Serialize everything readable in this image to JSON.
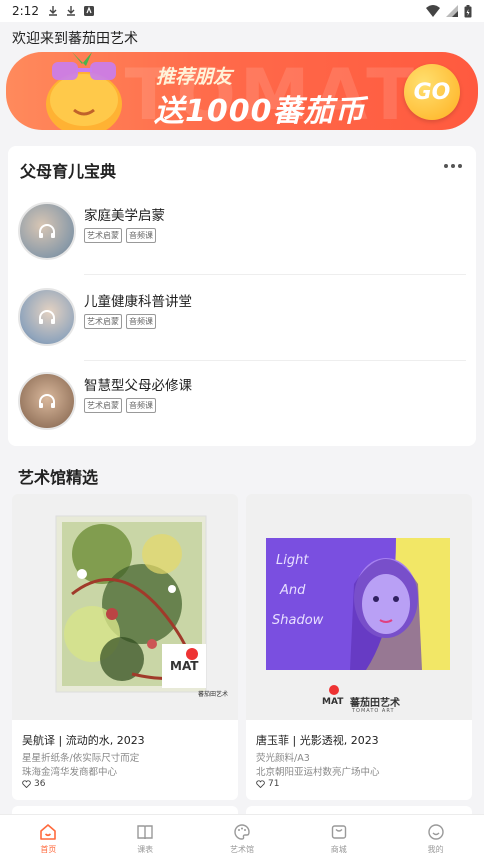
{
  "status_bar": {
    "time": "2:12"
  },
  "welcome": "欢迎来到蕃茄田艺术",
  "banner": {
    "line1": "推荐朋友",
    "line2": "送1000蕃茄币",
    "go_label": "GO",
    "bg_text": "TOMAT"
  },
  "courses_card": {
    "title": "父母育儿宝典",
    "items": [
      {
        "name": "家庭美学启蒙",
        "tags": [
          "艺术启蒙",
          "音频课"
        ]
      },
      {
        "name": "儿童健康科普讲堂",
        "tags": [
          "艺术启蒙",
          "音频课"
        ]
      },
      {
        "name": "智慧型父母必修课",
        "tags": [
          "艺术启蒙",
          "音频课"
        ]
      }
    ]
  },
  "gallery": {
    "title": "艺术馆精选",
    "works": [
      {
        "title": "吴航译 | 流动的水, 2023",
        "material": "星星折纸条/依实际尺寸而定",
        "center": "珠海金湾华发商都中心",
        "likes": "36",
        "logo_small": "蕃茄田艺术",
        "logo_sub": "TOMATO ART"
      },
      {
        "title": "唐玉菲 | 光影透视, 2023",
        "material": "荧光颜料/A3",
        "center": "北京朝阳亚运村数亮广场中心",
        "likes": "71",
        "logo_small": "蕃茄田艺术",
        "logo_sub": "TOMATO ART",
        "painting_text": "Light And Shadow"
      }
    ]
  },
  "nav": {
    "tabs": [
      {
        "label": "首页",
        "icon": "home-icon",
        "active": true
      },
      {
        "label": "课表",
        "icon": "book-icon"
      },
      {
        "label": "艺术馆",
        "icon": "palette-icon"
      },
      {
        "label": "商城",
        "icon": "shop-icon"
      },
      {
        "label": "我的",
        "icon": "smile-icon"
      }
    ]
  },
  "colors": {
    "accent": "#ff6a3d",
    "banner_start": "#ff8a5c",
    "banner_end": "#ff5a3f"
  }
}
